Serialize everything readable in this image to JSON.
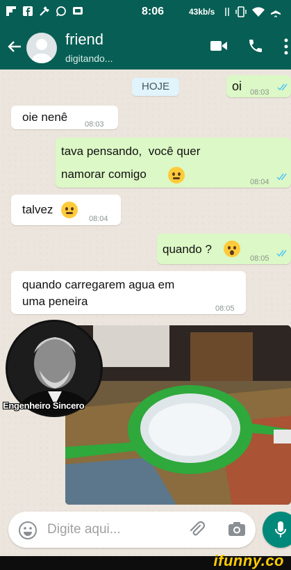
{
  "status_bar": {
    "time": "8:06",
    "speed": "43kb/s",
    "icons": [
      "flipboard-icon",
      "facebook-icon",
      "tools-icon",
      "whatsapp-icon",
      "message-icon",
      "vibrate-icon",
      "wifi-icon",
      "airplane-icon"
    ]
  },
  "header": {
    "contact_name": "friend",
    "contact_status": "digitando...",
    "icons": [
      "back-arrow-icon",
      "avatar",
      "video-call-icon",
      "phone-icon",
      "more-vert-icon"
    ]
  },
  "chat": {
    "date_label": "HOJE",
    "messages": [
      {
        "direction": "out",
        "text": "oi",
        "time": "08:03"
      },
      {
        "direction": "in",
        "text": "oie nenê",
        "time": "08:03"
      },
      {
        "direction": "out",
        "text_line1": "tava pensando,  você quer",
        "text_line2": "namorar comigo",
        "emoji": "thinking-emoji",
        "time": "08:04"
      },
      {
        "direction": "in",
        "text": "talvez",
        "emoji": "thinking-emoji",
        "time": "08:04"
      },
      {
        "direction": "out",
        "text": "quando ?",
        "emoji": "astonished-emoji",
        "time": "08:05"
      },
      {
        "direction": "in",
        "text_line1": "quando carregarem agua em",
        "text_line2": "uma peneira",
        "time": "08:05"
      }
    ],
    "meme_caption": "Engenheiro Sincero"
  },
  "input": {
    "placeholder": "Digite aqui...",
    "icons": [
      "emoji-icon",
      "attach-icon",
      "camera-icon",
      "mic-icon"
    ]
  },
  "watermark": "ifunny.co",
  "colors": {
    "header_green": "#075e54",
    "outgoing_bubble": "#dcf8c6",
    "incoming_bubble": "#ffffff",
    "chat_background": "#ece5dd",
    "mic_button": "#00897b",
    "read_ticks": "#4fc3f7"
  }
}
